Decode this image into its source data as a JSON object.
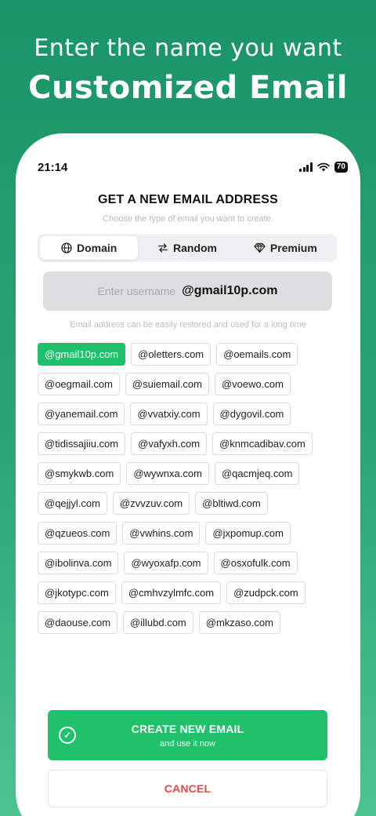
{
  "headline": {
    "sub": "Enter the name you want",
    "main": "Customized Email"
  },
  "status_bar": {
    "time": "21:14",
    "battery": "70",
    "icons": [
      "signal-icon",
      "wifi-icon",
      "battery-icon"
    ]
  },
  "page": {
    "title": "GET A NEW EMAIL ADDRESS",
    "subtitle": "Choose the type of email you want to create."
  },
  "tabs": [
    {
      "label": "Domain",
      "icon": "globe-icon",
      "active": true
    },
    {
      "label": "Random",
      "icon": "swap-arrows-icon",
      "active": false
    },
    {
      "label": "Premium",
      "icon": "diamond-icon",
      "active": false
    }
  ],
  "username": {
    "placeholder": "Enter username",
    "domain": "@gmail10p.com"
  },
  "hint": "Email address can be easily restored and used for a long time",
  "domains": [
    "@gmail10p.com",
    "@oletters.com",
    "@oemails.com",
    "@oegmail.com",
    "@suiemail.com",
    "@voewo.com",
    "@yanemail.com",
    "@vvatxiy.com",
    "@dygovil.com",
    "@tidissajiiu.com",
    "@vafyxh.com",
    "@knmcadibav.com",
    "@smykwb.com",
    "@wywnxa.com",
    "@qacmjeq.com",
    "@qejjyl.com",
    "@zvvzuv.com",
    "@bltiwd.com",
    "@qzueos.com",
    "@vwhins.com",
    "@jxpomup.com",
    "@ibolinva.com",
    "@wyoxafp.com",
    "@osxofulk.com",
    "@jkotypc.com",
    "@cmhvzylmfc.com",
    "@zudpck.com",
    "@daouse.com",
    "@illubd.com",
    "@mkzaso.com"
  ],
  "selected_domain": "@gmail10p.com",
  "create_button": {
    "label": "CREATE NEW EMAIL",
    "sublabel": "and use it now",
    "icon": "check-circle-icon"
  },
  "cancel_button": {
    "label": "CANCEL"
  },
  "colors": {
    "accent": "#1fc16b",
    "danger": "#e44b4b",
    "background": "#1a9466"
  }
}
